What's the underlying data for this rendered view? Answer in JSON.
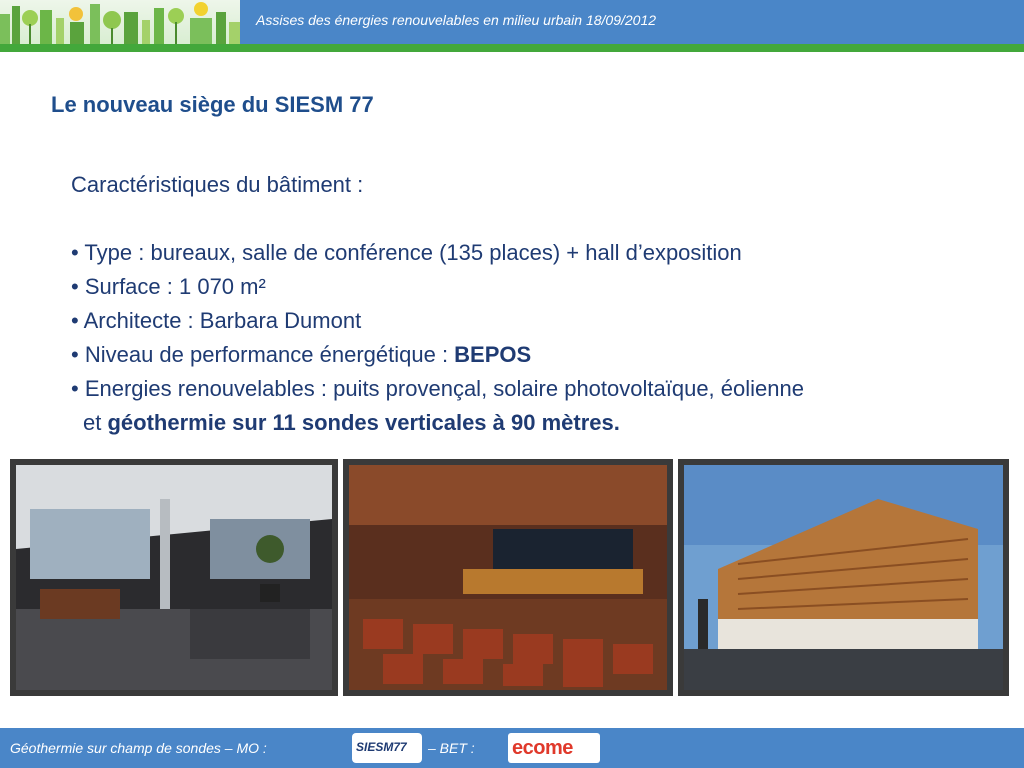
{
  "header": {
    "title": "Assises des énergies renouvelables en milieu urbain 18/09/2012"
  },
  "slide": {
    "title": "Le nouveau siège du SIESM 77",
    "subtitle": "Caractéristiques du bâtiment :",
    "bullets": {
      "type": "Type : bureaux, salle de conférence (135 places) + hall d’exposition",
      "surface": "Surface : 1 070 m²",
      "architect": "Architecte : Barbara Dumont",
      "performance_prefix": "Niveau de performance énergétique : ",
      "performance_value": "BEPOS",
      "energies": "Energies renouvelables :  puits provençal, solaire photovoltaïque, éolienne",
      "energies_cont_prefix": "et ",
      "energies_cont_bold": "géothermie sur 11 sondes verticales à 90 mètres."
    }
  },
  "photos": [
    {
      "name": "office-interior-photo"
    },
    {
      "name": "conference-room-photo"
    },
    {
      "name": "building-exterior-photo"
    }
  ],
  "footer": {
    "left_text": "Géothermie sur champ de sondes  –  MO :",
    "mo_logo_text": "SIESM77",
    "right_text": "–   BET :",
    "bet_logo_text": "ecome"
  },
  "colors": {
    "header_bar": "#4a86c8",
    "accent_green": "#43a83b",
    "title_blue": "#1f4e8c",
    "text_blue": "#1f3b73",
    "bet_logo_red": "#e0392b"
  }
}
